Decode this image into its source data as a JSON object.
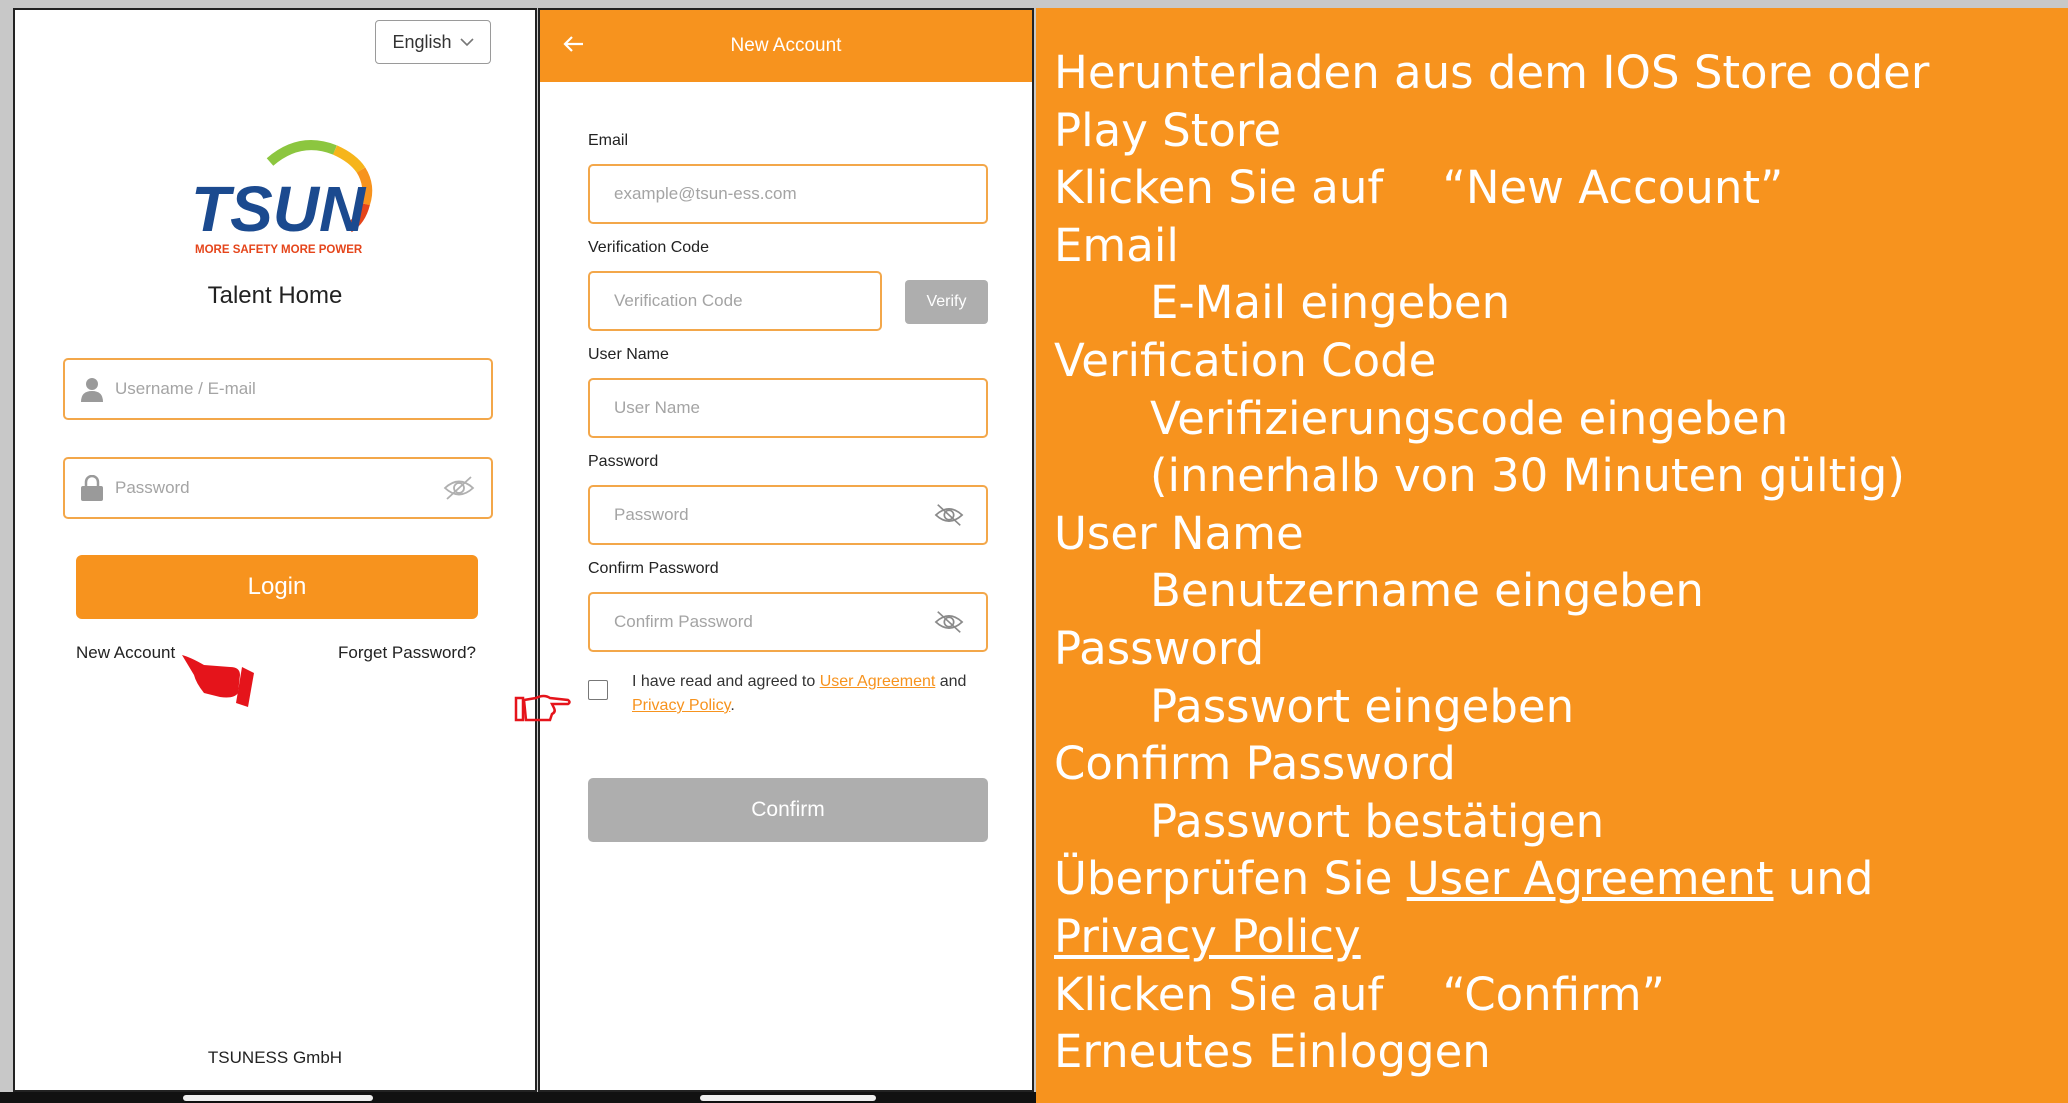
{
  "login": {
    "language": "English",
    "logo_text": "TSUN",
    "logo_tagline": "MORE SAFETY MORE POWER",
    "app_name": "Talent Home",
    "username_placeholder": "Username / E-mail",
    "password_placeholder": "Password",
    "login_button": "Login",
    "new_account_link": "New Account",
    "forget_password_link": "Forget Password?",
    "footer": "TSUNESS GmbH"
  },
  "register": {
    "title": "New Account",
    "email_label": "Email",
    "email_placeholder": "example@tsun-ess.com",
    "verification_label": "Verification Code",
    "verification_placeholder": "Verification Code",
    "verify_button": "Verify",
    "username_label": "User Name",
    "username_placeholder": "User Name",
    "password_label": "Password",
    "password_placeholder": "Password",
    "confirm_label": "Confirm Password",
    "confirm_placeholder": "Confirm Password",
    "agree_prefix": "I have read and agreed to ",
    "user_agreement": "User Agreement",
    "agree_and": " and ",
    "privacy_policy": "Privacy Policy",
    "agree_suffix": ".",
    "confirm_button": "Confirm"
  },
  "instructions": {
    "l1": "Herunterladen aus dem IOS Store oder",
    "l2": "Play Store",
    "l3": "Klicken Sie auf 　“New Account”",
    "l4": "Email",
    "l5": "E-Mail eingeben",
    "l6": "Verification Code",
    "l7": "Verifizierungscode eingeben",
    "l8": "(innerhalb von 30 Minuten gültig)",
    "l9": "User Name",
    "l10": "Benutzername eingeben",
    "l11": "Password",
    "l12": "Passwort eingeben",
    "l13": "Confirm Password",
    "l14": "Passwort bestätigen",
    "l15_pre": "Überprüfen Sie ",
    "l15_link": "User Agreement",
    "l15_post": " und",
    "l16": "Privacy Policy",
    "l17": "Klicken Sie auf 　“Confirm”",
    "l18": "Erneutes Einloggen"
  },
  "colors": {
    "accent": "#f7931e",
    "disabled": "#aeaeae",
    "pointer": "#e5141b"
  }
}
